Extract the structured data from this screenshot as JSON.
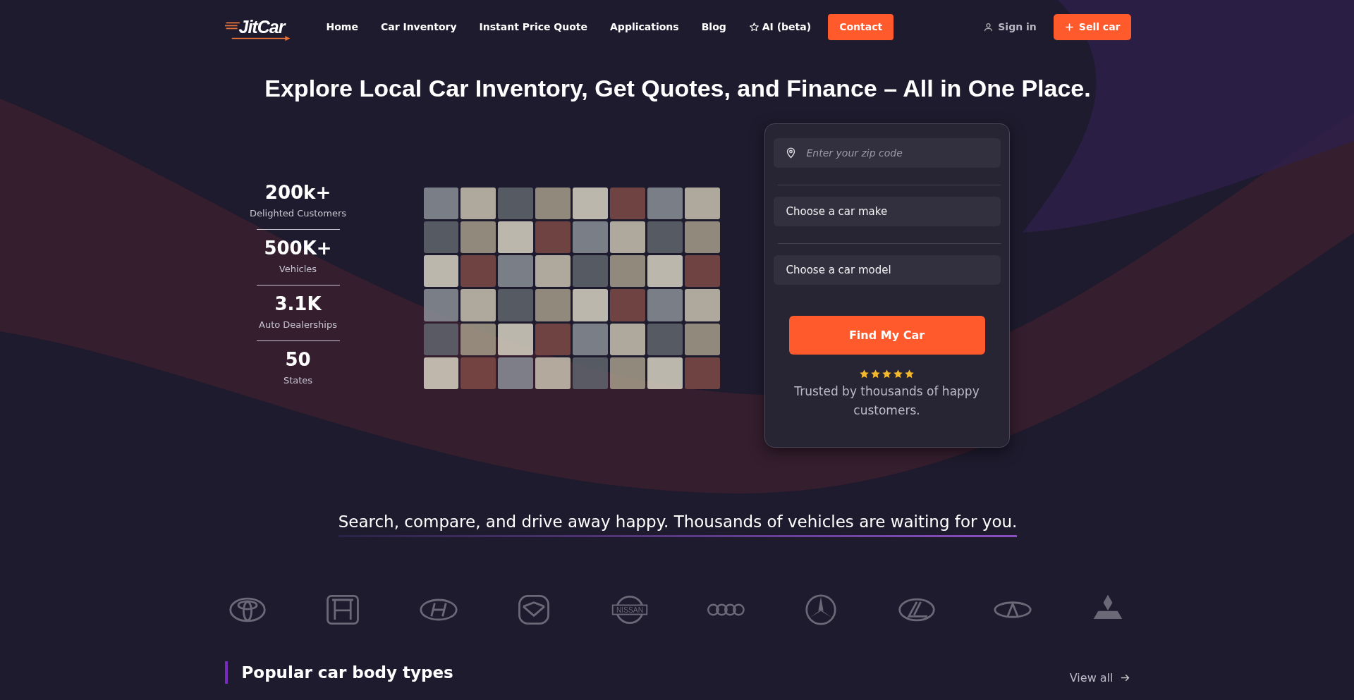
{
  "header": {
    "logo": "JitCar",
    "nav": [
      {
        "label": "Home",
        "kind": "link"
      },
      {
        "label": "Car Inventory",
        "kind": "link"
      },
      {
        "label": "Instant Price Quote",
        "kind": "link"
      },
      {
        "label": "Applications",
        "kind": "link"
      },
      {
        "label": "Blog",
        "kind": "link"
      },
      {
        "label": "AI (beta)",
        "kind": "star-link"
      },
      {
        "label": "Contact",
        "kind": "button"
      }
    ],
    "sign_in": "Sign in",
    "sell_car": "Sell car"
  },
  "hero": {
    "title": "Explore Local Car Inventory, Get Quotes, and Finance – All in One Place.",
    "stats": [
      {
        "value": "200k+",
        "label": "Delighted Customers"
      },
      {
        "value": "500K+",
        "label": "Vehicles"
      },
      {
        "value": "3.1K",
        "label": "Auto Dealerships"
      },
      {
        "value": "50",
        "label": "States"
      }
    ],
    "search_form": {
      "zip_placeholder": "Enter your zip code",
      "make": "Choose a car make",
      "model": "Choose a car model",
      "button": "Find My Car",
      "stars": 5,
      "trust_text": "Trusted by thousands of happy customers."
    }
  },
  "tagline": "Search, compare, and drive away happy. Thousands of vehicles are waiting for you.",
  "brand_logos": [
    {
      "kind": "toyota"
    },
    {
      "kind": "honda"
    },
    {
      "kind": "hyundai"
    },
    {
      "kind": "mazda"
    },
    {
      "kind": "nissan",
      "label": "NISSAN"
    },
    {
      "kind": "audi"
    },
    {
      "kind": "mercedes"
    },
    {
      "kind": "lexus"
    },
    {
      "kind": "infiniti"
    },
    {
      "kind": "mitsubishi"
    }
  ],
  "body_types": {
    "title": "Popular car body types",
    "view_all": "View all"
  }
}
